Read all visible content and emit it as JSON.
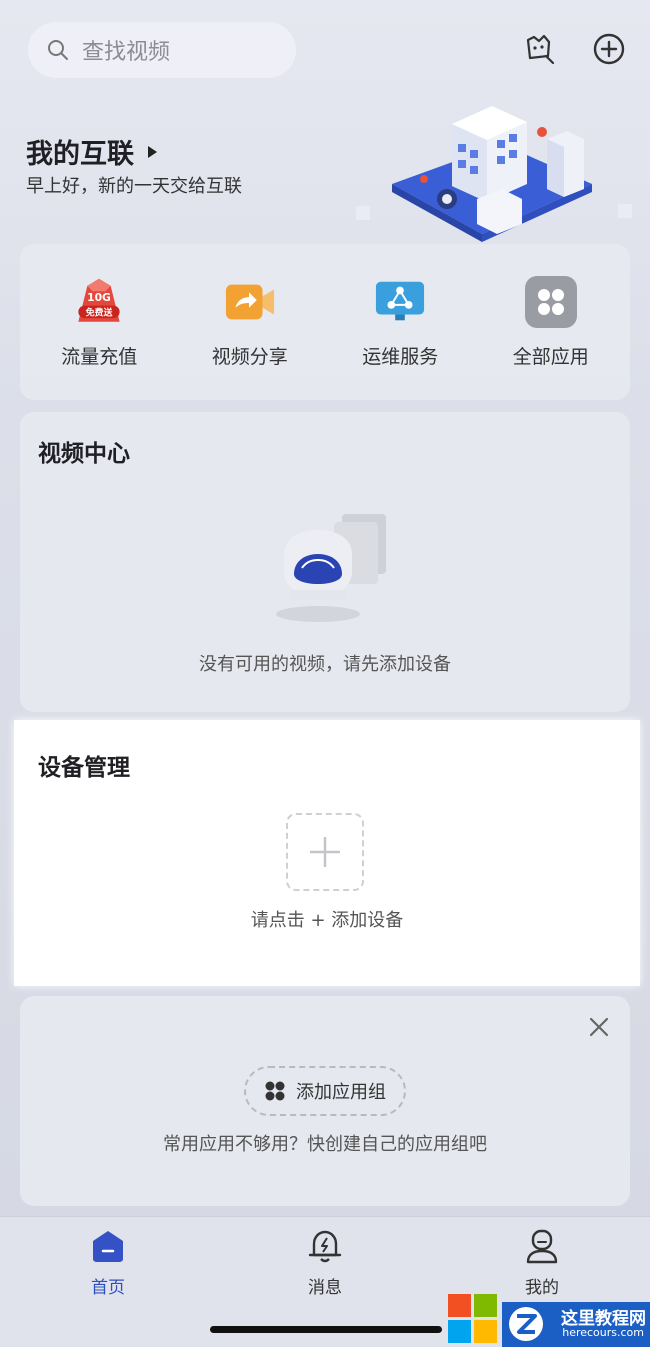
{
  "header": {
    "search_placeholder": "查找视频",
    "title": "我的互联",
    "subtitle": "早上好，新的一天交给互联",
    "icons": [
      "search-icon",
      "scan-face-icon",
      "add-circle-icon"
    ]
  },
  "apps": [
    {
      "label": "流量充值",
      "badge_top": "10G",
      "badge_bottom": "免费送",
      "icon": "data-topup-icon"
    },
    {
      "label": "视频分享",
      "icon": "video-share-icon"
    },
    {
      "label": "运维服务",
      "icon": "ops-service-icon"
    },
    {
      "label": "全部应用",
      "icon": "all-apps-icon"
    }
  ],
  "video_center": {
    "title": "视频中心",
    "empty_text": "没有可用的视频，请先添加设备"
  },
  "device_management": {
    "title": "设备管理",
    "hint": "请点击 + 添加设备"
  },
  "app_group": {
    "button_label": "添加应用组",
    "tip": "常用应用不够用？快创建自己的应用组吧"
  },
  "tabbar": {
    "items": [
      {
        "label": "首页",
        "icon": "home-icon",
        "active": true
      },
      {
        "label": "消息",
        "icon": "bell-icon",
        "active": false
      },
      {
        "label": "我的",
        "icon": "profile-icon",
        "active": false
      }
    ]
  },
  "watermark": {
    "name": "这里教程网",
    "url": "herecours.com"
  },
  "colors": {
    "accent": "#2e4fc0",
    "background": "#dcdfe9",
    "card": "#e8eaf1"
  }
}
